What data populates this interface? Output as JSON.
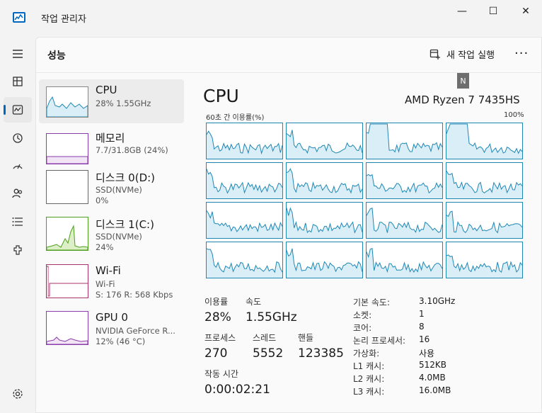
{
  "window": {
    "title": "작업 관리자",
    "minimize_glyph": "—",
    "maximize_glyph": "☐",
    "close_glyph": "✕"
  },
  "header": {
    "title": "성능",
    "run_new_task": "새 작업 실행",
    "more_glyph": "···",
    "tooltip": "N"
  },
  "nav": {
    "items": [
      {
        "name": "menu-icon"
      },
      {
        "name": "processes-icon"
      },
      {
        "name": "performance-icon"
      },
      {
        "name": "app-history-icon"
      },
      {
        "name": "startup-icon"
      },
      {
        "name": "users-icon"
      },
      {
        "name": "details-icon"
      },
      {
        "name": "services-icon"
      },
      {
        "name": "settings-icon"
      }
    ]
  },
  "sidebar": {
    "items": [
      {
        "title": "CPU",
        "sub1": "28% 1.55GHz",
        "sub2": "",
        "sub3": ""
      },
      {
        "title": "메모리",
        "sub1": "7.7/31.8GB (24%)",
        "sub2": "",
        "sub3": ""
      },
      {
        "title": "디스크 0(D:)",
        "sub1": "SSD(NVMe)",
        "sub2": "0%",
        "sub3": ""
      },
      {
        "title": "디스크 1(C:)",
        "sub1": "SSD(NVMe)",
        "sub2": "24%",
        "sub3": ""
      },
      {
        "title": "Wi-Fi",
        "sub1": "Wi-Fi",
        "sub2": "S: 176 R: 568 Kbps",
        "sub3": ""
      },
      {
        "title": "GPU 0",
        "sub1": "NVIDIA GeForce R...",
        "sub2": "12% (46 °C)",
        "sub3": ""
      }
    ]
  },
  "detail": {
    "title": "CPU",
    "model": "AMD Ryzen 7 7435HS",
    "util_label": "60초 간 이용률(%)",
    "util_max": "100%"
  },
  "stats": {
    "usage_label": "이용률",
    "usage_value": "28%",
    "speed_label": "속도",
    "speed_value": "1.55GHz",
    "processes_label": "프로세스",
    "processes_value": "270",
    "threads_label": "스레드",
    "threads_value": "5552",
    "handles_label": "핸들",
    "handles_value": "123385",
    "uptime_label": "작동 시간",
    "uptime_value": "0:00:02:21"
  },
  "specs": [
    {
      "label": "기본 속도:",
      "value": "3.10GHz"
    },
    {
      "label": "소켓:",
      "value": "1"
    },
    {
      "label": "코어:",
      "value": "8"
    },
    {
      "label": "논리 프로세서:",
      "value": "16"
    },
    {
      "label": "가상화:",
      "value": "사용"
    },
    {
      "label": "L1 캐시:",
      "value": "512KB"
    },
    {
      "label": "L2 캐시:",
      "value": "4.0MB"
    },
    {
      "label": "L3 캐시:",
      "value": "16.0MB"
    }
  ],
  "colors": {
    "cpu_line": "#1e87b4",
    "cpu_fill": "#d9eef7",
    "mem_line": "#8b3cab",
    "disk_line": "#4d9e1c",
    "disk_fill": "#dcefc6",
    "wifi_line": "#a8326b",
    "accent": "#0067c0"
  }
}
